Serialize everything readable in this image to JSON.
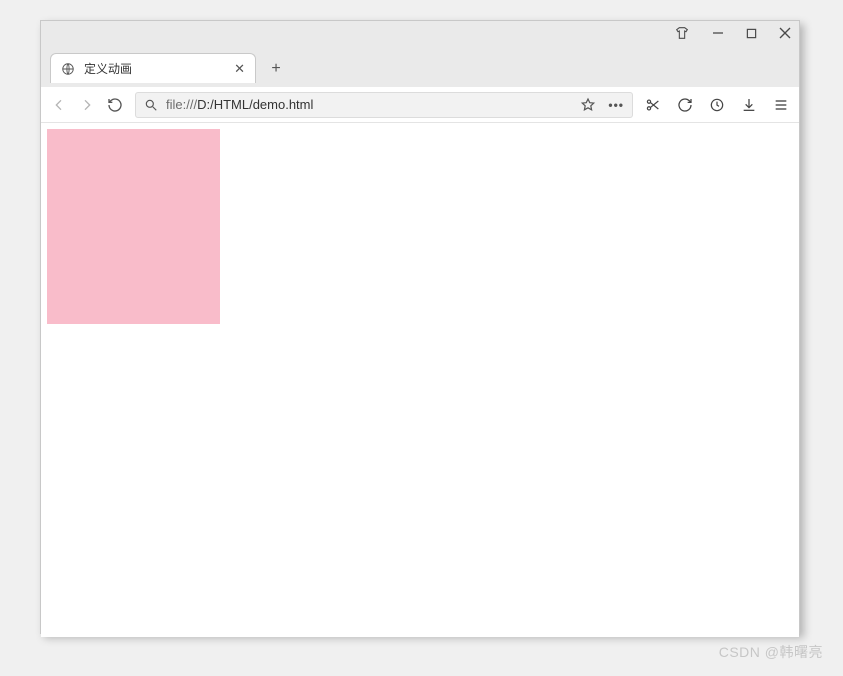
{
  "tab": {
    "title": "定义动画"
  },
  "address": {
    "scheme": "file:///",
    "rest": "D:/HTML/demo.html"
  },
  "watermark": "CSDN @韩曙亮"
}
